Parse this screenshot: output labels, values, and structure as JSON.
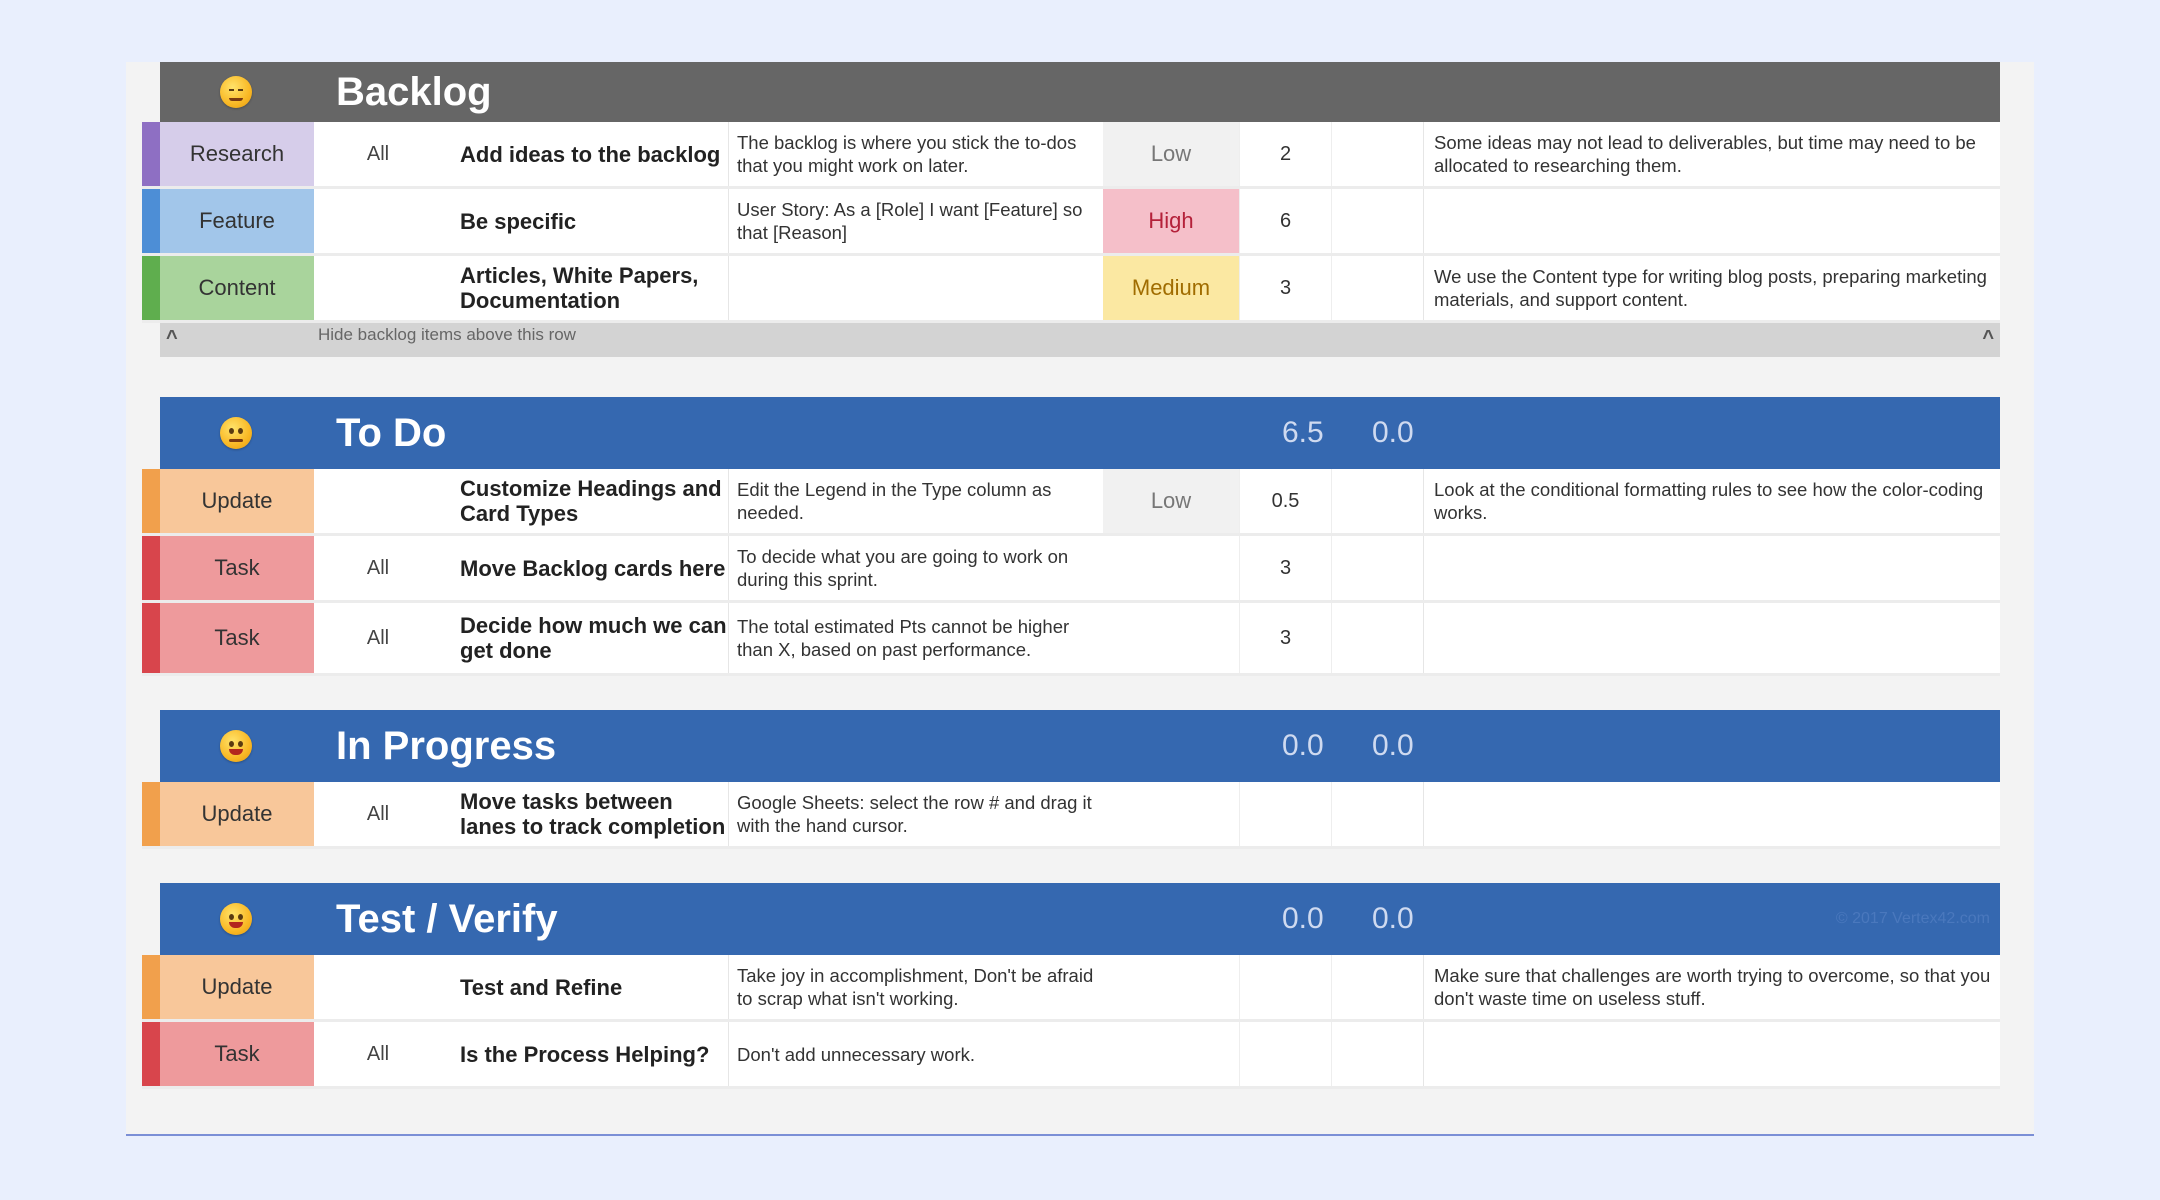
{
  "lanes": {
    "backlog": {
      "title": "Backlog",
      "rows": [
        {
          "type": "Research",
          "who": "All",
          "task": "Add ideas to the backlog",
          "desc": "The backlog is where you stick the to-dos that you might work on later.",
          "priority": "Low",
          "pts": "2",
          "notes": "Some ideas may not lead to deliverables, but time may need to be allocated to researching them."
        },
        {
          "type": "Feature",
          "who": "",
          "task": "Be specific",
          "desc": "User Story: As a [Role] I want [Feature] so that [Reason]",
          "priority": "High",
          "pts": "6",
          "notes": ""
        },
        {
          "type": "Content",
          "who": "",
          "task": "Articles, White Papers, Documentation",
          "desc": "",
          "priority": "Medium",
          "pts": "3",
          "notes": "We use the Content type for writing blog posts, preparing marketing materials, and support content."
        }
      ],
      "hide_row": {
        "caret_left": "^",
        "text": "Hide backlog items above this row",
        "caret_right": "^"
      }
    },
    "todo": {
      "title": "To Do",
      "total_a": "6.5",
      "total_b": "0.0",
      "rows": [
        {
          "type": "Update",
          "who": "",
          "task": "Customize Headings and Card Types",
          "desc": "Edit the Legend in the Type column as needed.",
          "priority": "Low",
          "pts": "0.5",
          "notes": "Look at the conditional formatting rules to see how the color-coding works."
        },
        {
          "type": "Task",
          "who": "All",
          "task": "Move Backlog cards here",
          "desc": "To decide what you are going to work on during this sprint.",
          "priority": "",
          "pts": "3",
          "notes": ""
        },
        {
          "type": "Task",
          "who": "All",
          "task": "Decide how much we can get done",
          "desc": "The total estimated Pts cannot be higher than X, based on past performance.",
          "priority": "",
          "pts": "3",
          "notes": ""
        }
      ]
    },
    "inprogress": {
      "title": "In Progress",
      "total_a": "0.0",
      "total_b": "0.0",
      "rows": [
        {
          "type": "Update",
          "who": "All",
          "task": "Move tasks between lanes to track completion",
          "desc": "Google Sheets: select the row # and drag it with the hand cursor.",
          "priority": "",
          "pts": "",
          "notes": ""
        }
      ]
    },
    "test": {
      "title": "Test / Verify",
      "total_a": "0.0",
      "total_b": "0.0",
      "watermark": "© 2017 Vertex42.com",
      "rows": [
        {
          "type": "Update",
          "who": "",
          "task": "Test and Refine",
          "desc": "Take joy in accomplishment, Don't be afraid to scrap what isn't working.",
          "priority": "",
          "pts": "",
          "notes": "Make sure that challenges are worth trying to overcome, so that you don't waste time on useless stuff."
        },
        {
          "type": "Task",
          "who": "All",
          "task": "Is the Process Helping?",
          "desc": "Don't add unnecessary work.",
          "priority": "",
          "pts": "",
          "notes": ""
        }
      ]
    }
  },
  "icons": {
    "lane_icon": "smiley-emoji-icon",
    "collapse_icon": "caret-up-icon"
  },
  "colors": {
    "header_gray": "#666666",
    "header_blue": "#3568b0",
    "research": "#d6cdea",
    "feature": "#a2c6ea",
    "content": "#a9d49c",
    "update": "#f8c79a",
    "task": "#ee9a9c",
    "priority_low": "#f1f1f1",
    "priority_high": "#f5bfc9",
    "priority_medium": "#fbe8a2"
  }
}
